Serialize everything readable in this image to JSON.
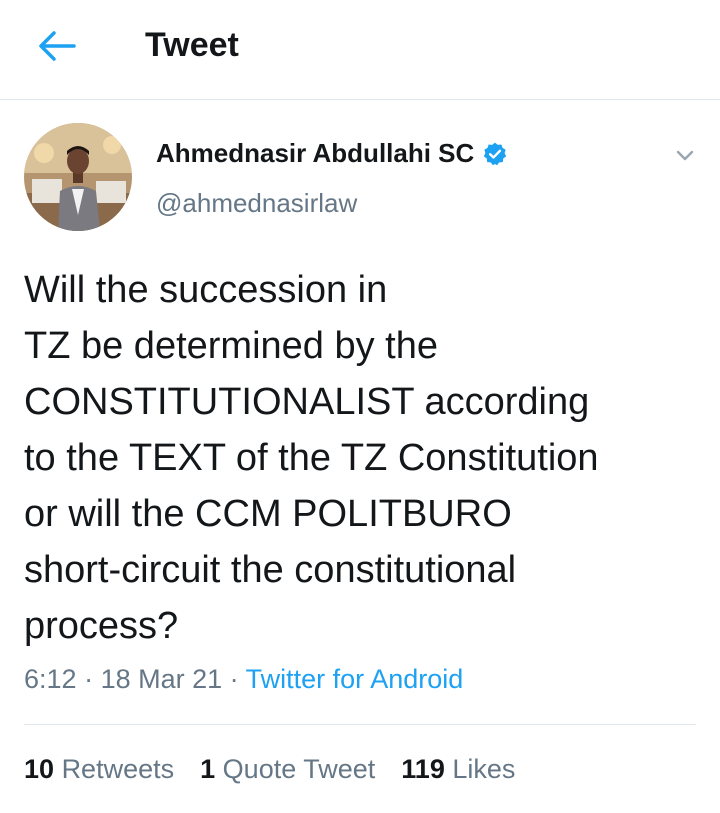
{
  "header": {
    "title": "Tweet",
    "back_icon": "arrow-left-icon"
  },
  "author": {
    "name": "Ahmednasir Abdullahi SC",
    "handle": "@ahmednasirlaw",
    "verified_icon": "verified-badge-icon",
    "avatar": "profile-photo"
  },
  "menu": {
    "caret_icon": "chevron-down-icon"
  },
  "tweet": {
    "lines": [
      "Will the succession in",
      "TZ be determined by the",
      "CONSTITUTIONALIST according",
      "to the TEXT of the TZ Constitution",
      "or will the CCM POLITBURO",
      "short-circuit the constitutional",
      "process?"
    ],
    "time": "6:12",
    "date": "18 Mar 21",
    "separator": " · ",
    "source": "Twitter for Android"
  },
  "stats": {
    "retweets_count": "10",
    "retweets_label": "Retweets",
    "quotes_count": "1",
    "quotes_label": "Quote Tweet",
    "likes_count": "119",
    "likes_label": "Likes"
  },
  "colors": {
    "accent": "#1da1f2",
    "text_primary": "#14171a",
    "text_secondary": "#657786",
    "divider": "#e1e8ed"
  }
}
